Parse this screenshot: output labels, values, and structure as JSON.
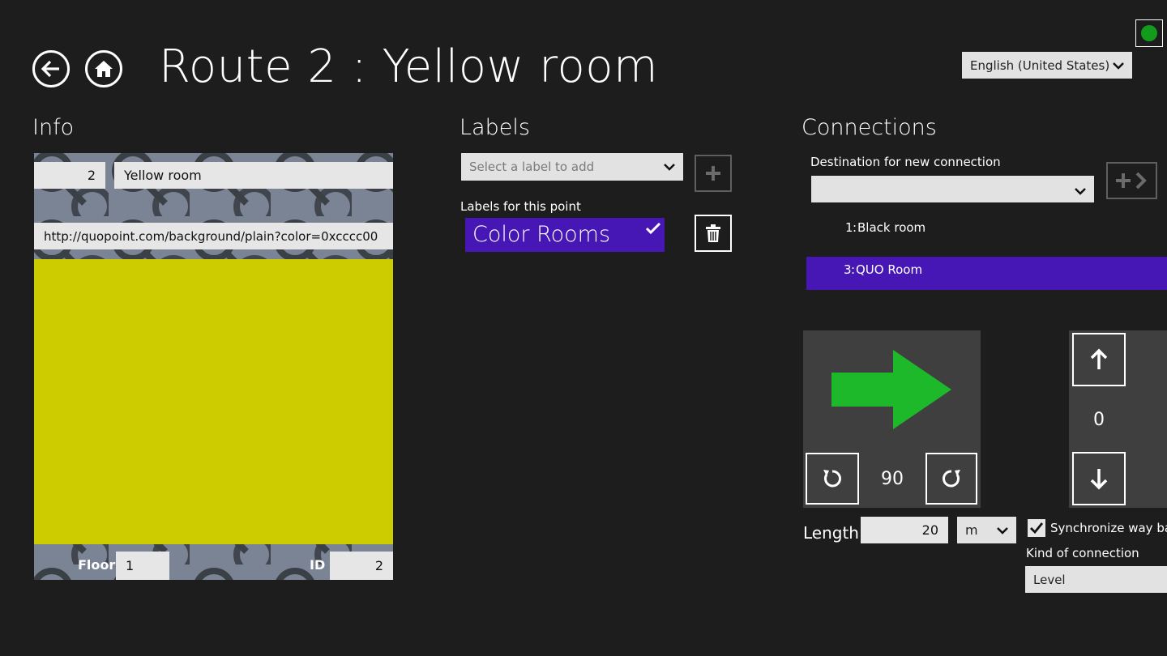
{
  "header": {
    "title": "Route 2 : Yellow room",
    "language": "English (United States)",
    "status_color": "#139b1c"
  },
  "info": {
    "heading": "Info",
    "number": "2",
    "name": "Yellow room",
    "url": "http://quopoint.com/background/plain?color=0xcccc00",
    "preview_color": "#cccc00",
    "floor_label": "Floor",
    "floor_value": "1",
    "id_label": "ID",
    "id_value": "2"
  },
  "labels": {
    "heading": "Labels",
    "select_placeholder": "Select a label to add",
    "list_caption": "Labels for this point",
    "items": [
      {
        "text": "Color Rooms",
        "selected": true
      }
    ],
    "accent": "#4617b4"
  },
  "connections": {
    "heading": "Connections",
    "destination_caption": "Destination for new connection",
    "destination_value": "",
    "items": [
      {
        "id": "1",
        "name": "Black room",
        "selected": false
      },
      {
        "id": "3",
        "name": "QUO Room",
        "selected": true
      }
    ],
    "direction_degrees": "90",
    "arrow_color": "#1db92b",
    "level_value": "0",
    "length_label": "Length",
    "length_value": "20",
    "length_unit": "m",
    "sync_label": "Synchronize way back",
    "sync_checked": true,
    "kind_label": "Kind of connection",
    "kind_value": "Level"
  }
}
